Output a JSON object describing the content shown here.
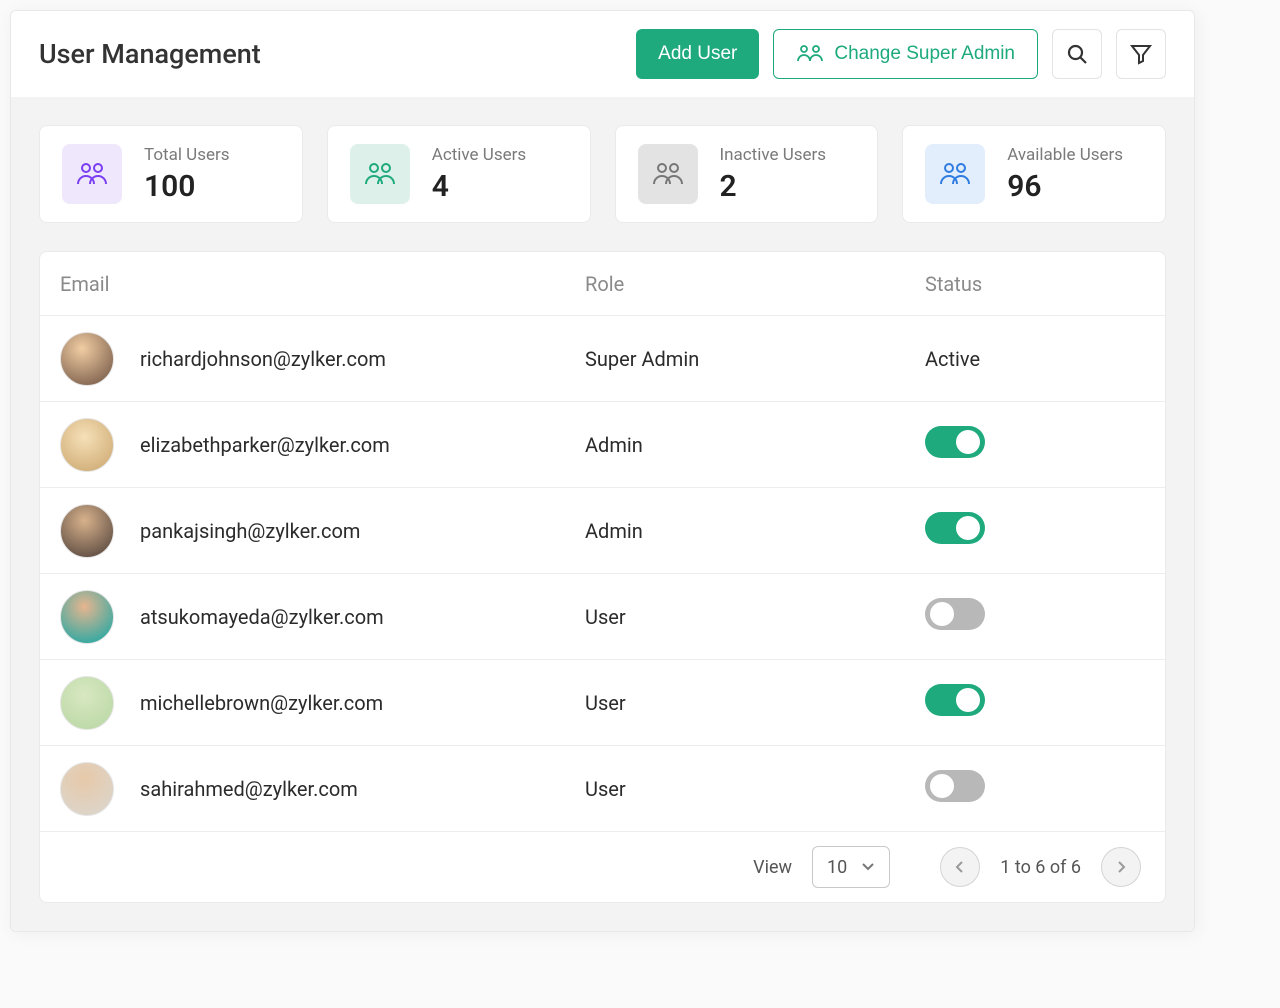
{
  "header": {
    "title": "User Management",
    "addUser": "Add User",
    "changeSuperAdmin": "Change Super Admin"
  },
  "stats": {
    "total": {
      "label": "Total Users",
      "value": "100"
    },
    "active": {
      "label": "Active Users",
      "value": "4"
    },
    "inactive": {
      "label": "Inactive Users",
      "value": "2"
    },
    "available": {
      "label": "Available Users",
      "value": "96"
    }
  },
  "columns": {
    "email": "Email",
    "role": "Role",
    "status": "Status"
  },
  "rows": [
    {
      "email": "richardjohnson@zylker.com",
      "role": "Super Admin",
      "statusText": "Active"
    },
    {
      "email": "elizabethparker@zylker.com",
      "role": "Admin",
      "toggleOn": true
    },
    {
      "email": "pankajsingh@zylker.com",
      "role": "Admin",
      "toggleOn": true
    },
    {
      "email": "atsukomayeda@zylker.com",
      "role": "User",
      "toggleOn": false
    },
    {
      "email": "michellebrown@zylker.com",
      "role": "User",
      "toggleOn": true
    },
    {
      "email": "sahirahmed@zylker.com",
      "role": "User",
      "toggleOn": false
    }
  ],
  "footer": {
    "viewLabel": "View",
    "pageSize": "10",
    "rangeText": "1 to 6 of 6"
  }
}
